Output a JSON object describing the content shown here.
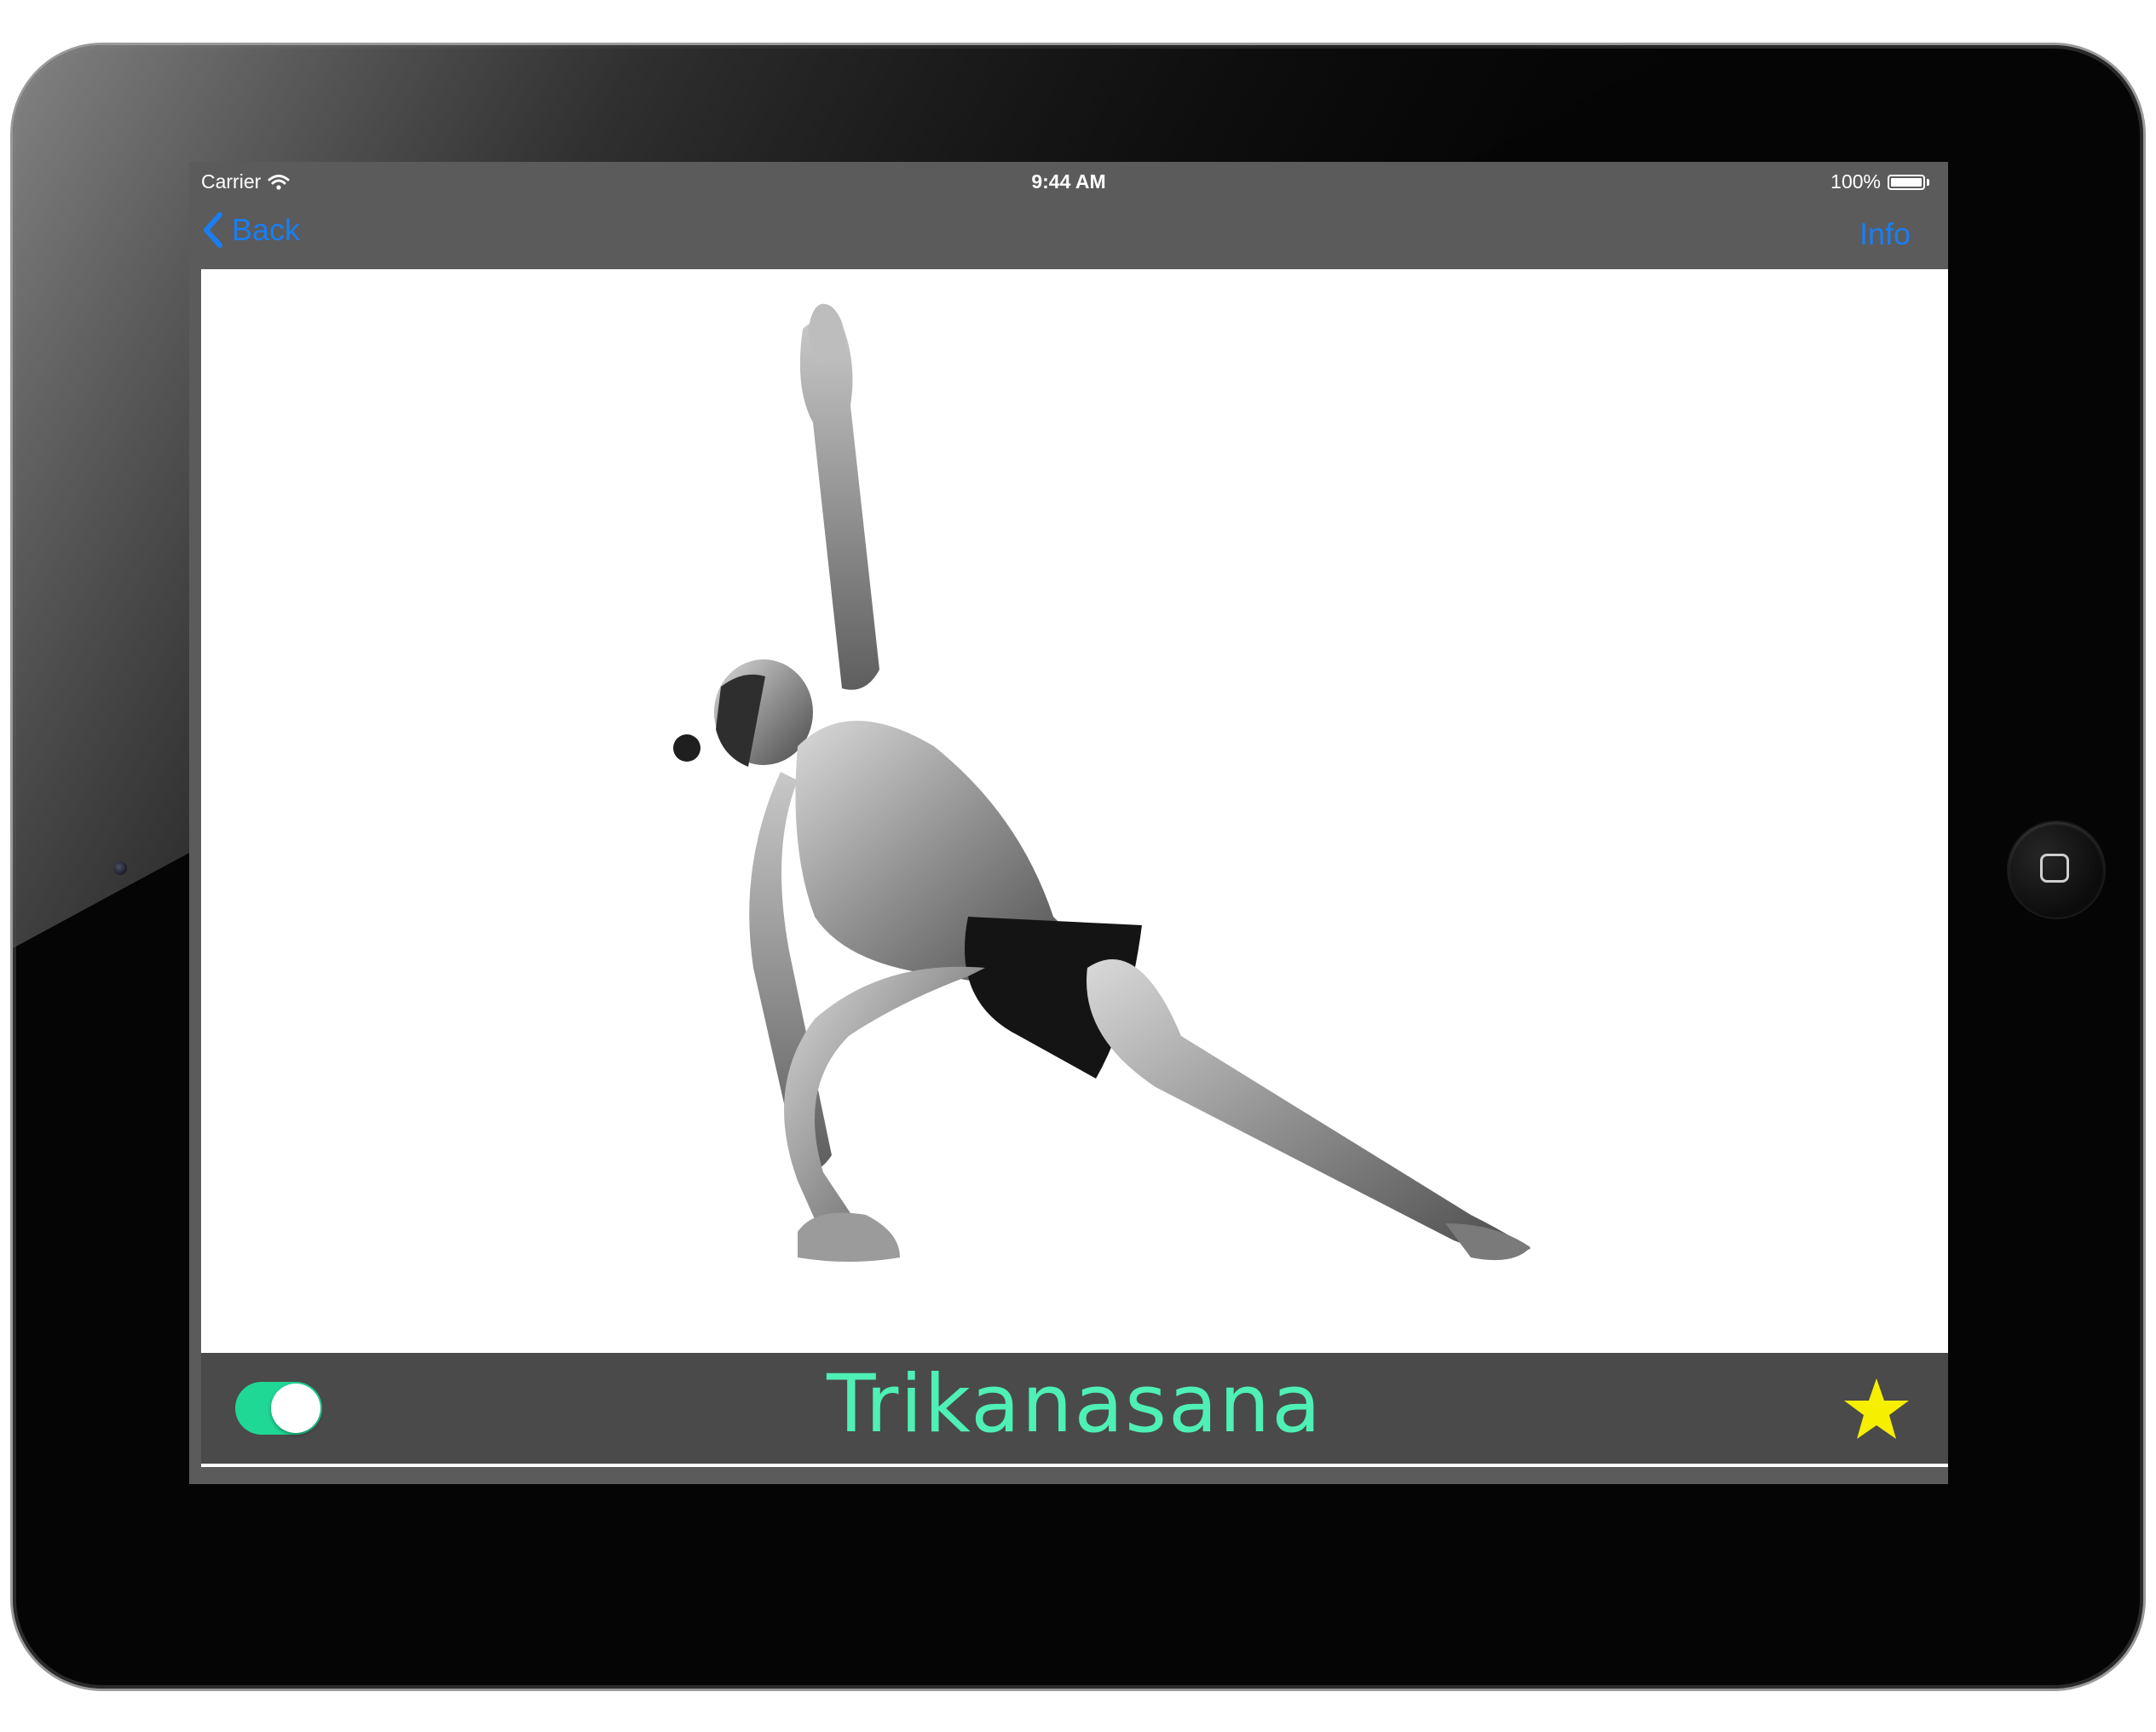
{
  "status_bar": {
    "carrier": "Carrier",
    "time": "9:44 AM",
    "battery": "100%",
    "battery_level": 1.0,
    "wifi_icon": "wifi-icon"
  },
  "nav": {
    "back_label": "Back",
    "info_label": "Info",
    "back_icon": "chevron-left-icon",
    "accent_color": "#1a7ef2"
  },
  "pose": {
    "name": "Trikanasana",
    "image": "man in revolved side angle yoga pose, black and white photograph"
  },
  "controls": {
    "toggle_on": true,
    "toggle_color": "#1fd895",
    "favorite_icon": "star-icon",
    "favorite_color": "#f6f000"
  },
  "colors": {
    "screen_background": "#5b5b5b",
    "title_color": "#4ef0b5"
  }
}
